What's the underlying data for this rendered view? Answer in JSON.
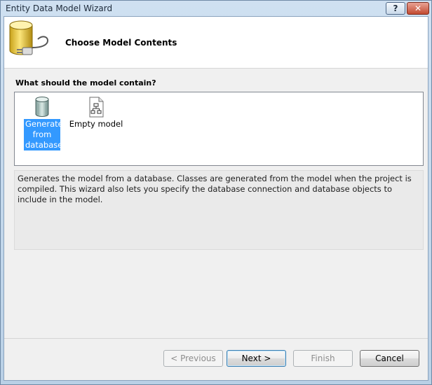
{
  "window": {
    "title": "Entity Data Model Wizard",
    "help_label": "?",
    "close_label": "✕"
  },
  "header": {
    "title": "Choose Model Contents",
    "icon": "database-plug-icon"
  },
  "question": "What should the model contain?",
  "model_options": [
    {
      "label": "Generate from database",
      "icon": "database-icon",
      "selected": true
    },
    {
      "label": "Empty model",
      "icon": "empty-model-icon",
      "selected": false
    }
  ],
  "description": "Generates the model from a database. Classes are generated from the model when the project is compiled. This wizard also lets you specify the database connection and database objects to include in the model.",
  "buttons": {
    "previous": {
      "label": "< Previous",
      "enabled": false
    },
    "next": {
      "label": "Next >",
      "enabled": true,
      "default": true
    },
    "finish": {
      "label": "Finish",
      "enabled": false
    },
    "cancel": {
      "label": "Cancel",
      "enabled": true
    }
  },
  "colors": {
    "selection": "#3399ff",
    "title_bar": "#cfe0f1"
  }
}
